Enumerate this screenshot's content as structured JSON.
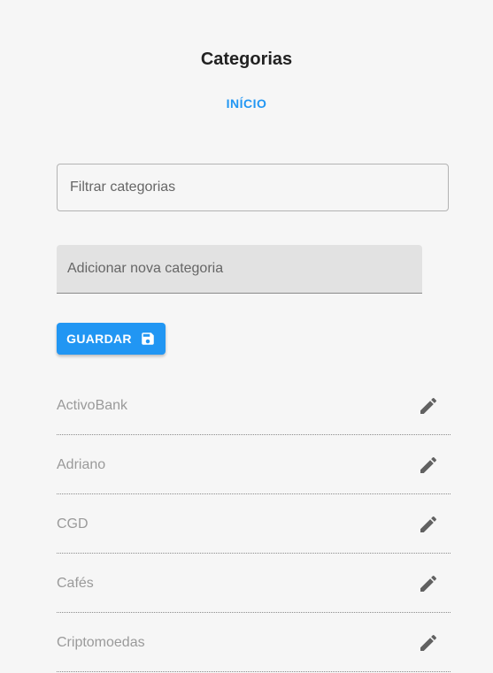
{
  "header": {
    "title": "Categorias",
    "home_link": "INÍCIO"
  },
  "filter": {
    "placeholder": "Filtrar categorias",
    "value": ""
  },
  "new_category": {
    "placeholder": "Adicionar nova categoria",
    "value": ""
  },
  "save_button": {
    "label": "GUARDAR",
    "icon": "save-icon"
  },
  "categories": [
    {
      "name": "ActivoBank",
      "icon": "pencil-icon"
    },
    {
      "name": "Adriano",
      "icon": "pencil-icon"
    },
    {
      "name": "CGD",
      "icon": "pencil-icon"
    },
    {
      "name": "Cafés",
      "icon": "pencil-icon"
    },
    {
      "name": "Criptomoedas",
      "icon": "pencil-icon"
    }
  ],
  "colors": {
    "accent": "#2196f3",
    "background": "#f6f6f6",
    "input_filled_bg": "#e2e2e2",
    "list_text": "#9a9a9a",
    "icon": "#616161"
  }
}
